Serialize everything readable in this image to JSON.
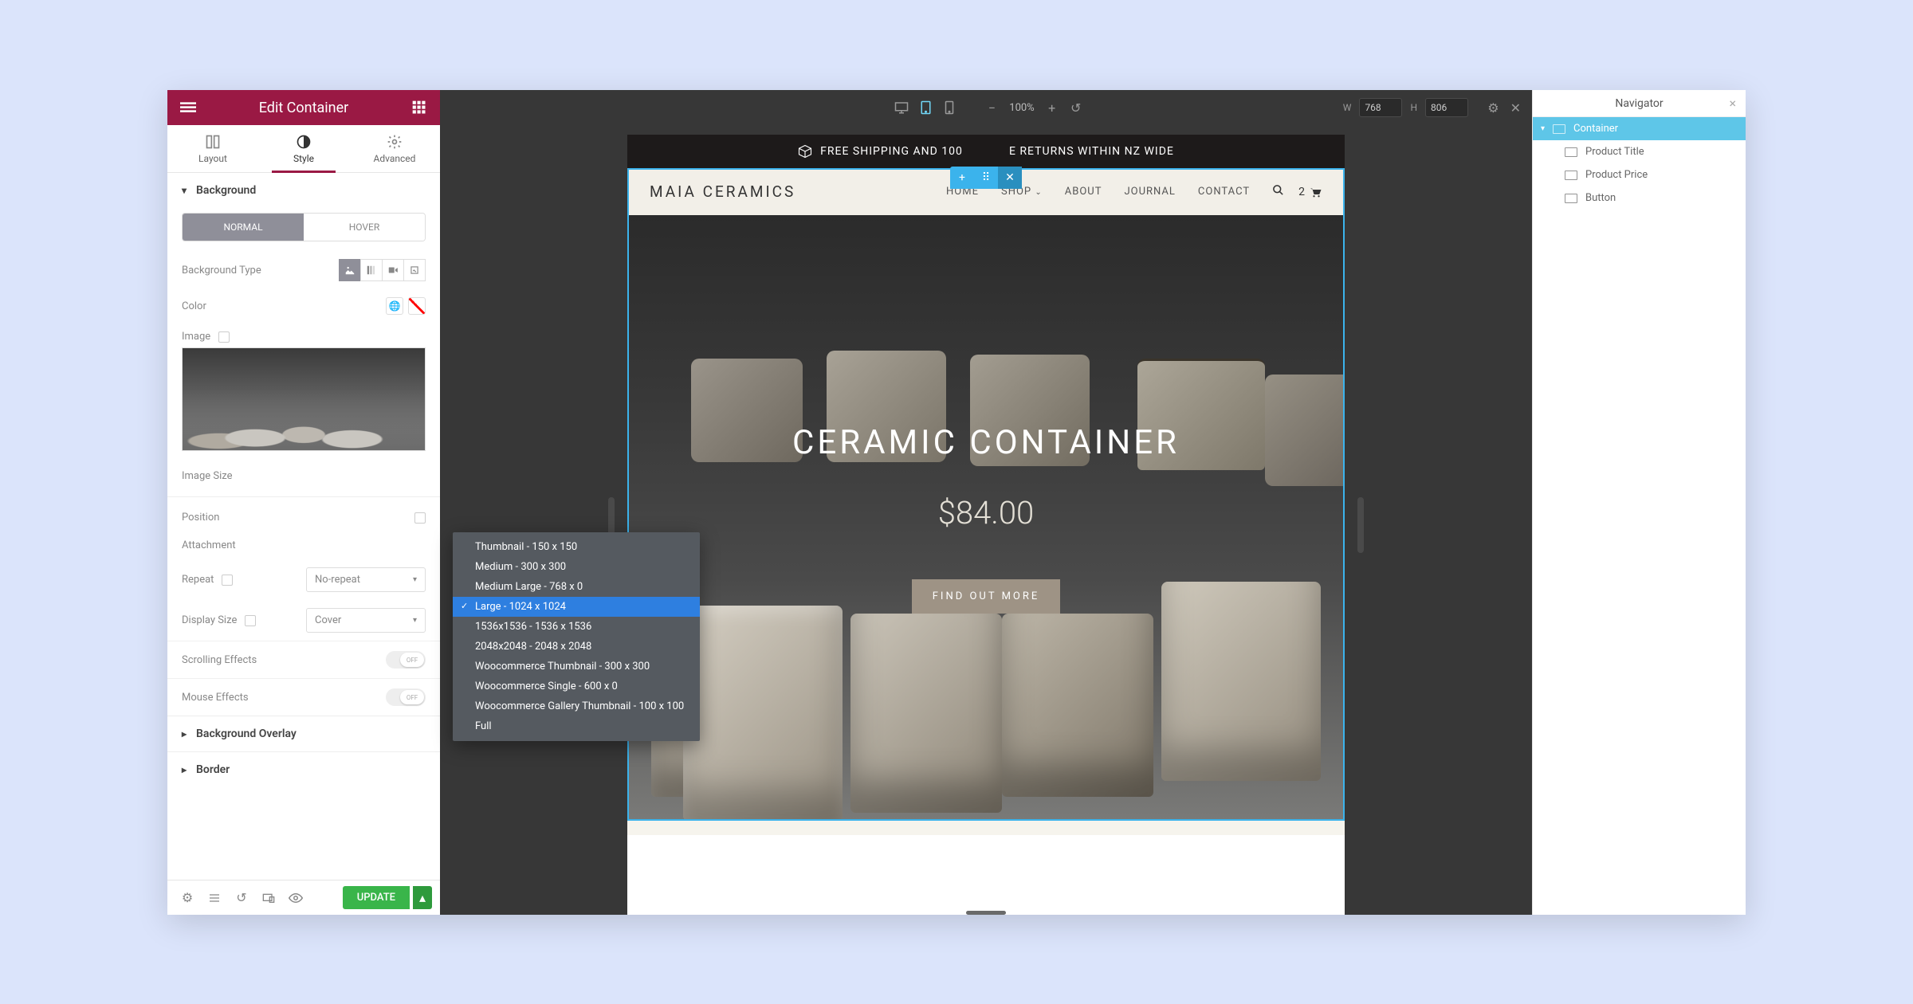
{
  "panel": {
    "title": "Edit Container",
    "tabs": {
      "layout": "Layout",
      "style": "Style",
      "advanced": "Advanced"
    },
    "sections": {
      "background": "Background",
      "background_overlay": "Background Overlay",
      "border": "Border"
    },
    "segmented": {
      "normal": "NORMAL",
      "hover": "HOVER"
    },
    "labels": {
      "bg_type": "Background Type",
      "color": "Color",
      "image": "Image",
      "image_size": "Image Size",
      "position": "Position",
      "attachment": "Attachment",
      "repeat": "Repeat",
      "display_size": "Display Size",
      "scrolling_effects": "Scrolling Effects",
      "mouse_effects": "Mouse Effects"
    },
    "values": {
      "repeat": "No-repeat",
      "display_size": "Cover",
      "toggle_off": "OFF"
    }
  },
  "dropdown": {
    "items": [
      "Thumbnail - 150 x 150",
      "Medium - 300 x 300",
      "Medium Large - 768 x 0",
      "Large - 1024 x 1024",
      "1536x1536 - 1536 x 1536",
      "2048x2048 - 2048 x 2048",
      "Woocommerce Thumbnail - 300 x 300",
      "Woocommerce Single - 600 x 0",
      "Woocommerce Gallery Thumbnail - 100 x 100",
      "Full"
    ],
    "selected_index": 3
  },
  "footer": {
    "update": "UPDATE"
  },
  "topbar": {
    "zoom": "100%",
    "w_label": "W",
    "w_value": "768",
    "h_label": "H",
    "h_value": "806"
  },
  "site": {
    "promo": "FREE SHIPPING AND 100             E RETURNS WITHIN NZ WIDE",
    "logo": "MAIA CERAMICS",
    "nav": [
      "HOME",
      "SHOP",
      "ABOUT",
      "JOURNAL",
      "CONTACT"
    ],
    "cart_count": "2",
    "hero_title": "CERAMIC CONTAINER",
    "hero_price": "$84.00",
    "hero_cta": "FIND OUT MORE"
  },
  "navigator": {
    "title": "Navigator",
    "items": [
      {
        "label": "Container",
        "root": true
      },
      {
        "label": "Product Title"
      },
      {
        "label": "Product Price"
      },
      {
        "label": "Button"
      }
    ]
  }
}
